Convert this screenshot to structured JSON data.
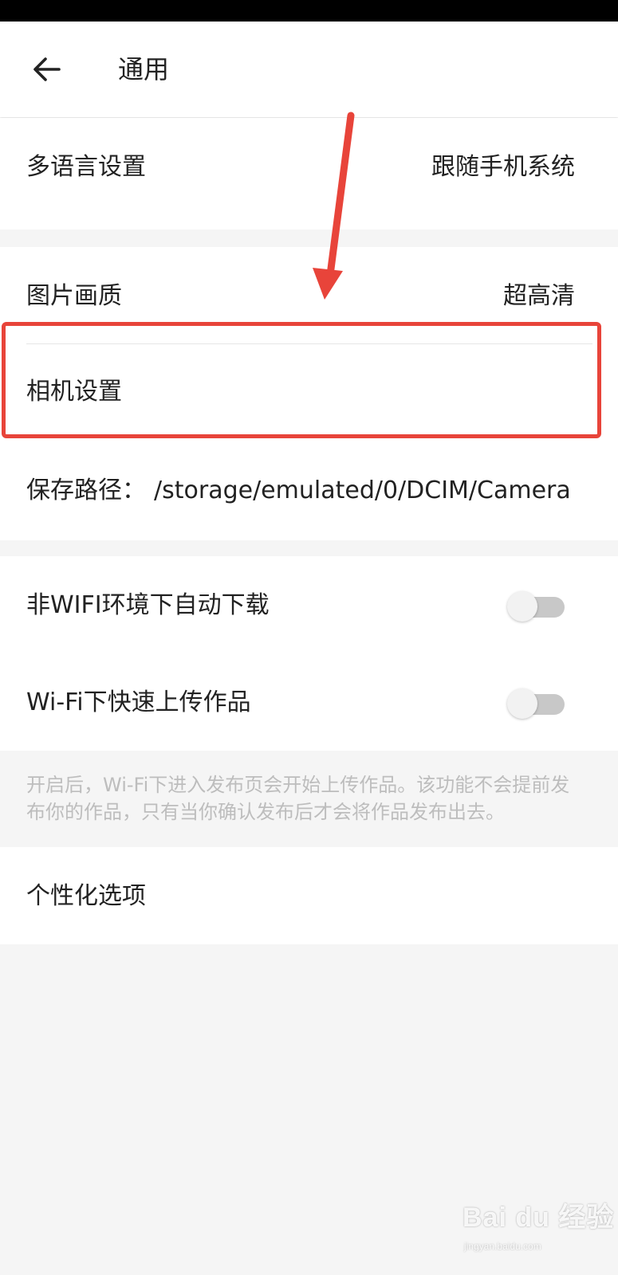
{
  "header": {
    "back_icon": "arrow-left-icon",
    "title": "通用"
  },
  "settings": {
    "language": {
      "label": "多语言设置",
      "value": "跟随手机系统"
    },
    "image_quality": {
      "label": "图片画质",
      "value": "超高清"
    },
    "camera": {
      "label": "相机设置"
    },
    "save_path": {
      "label": "保存路径：",
      "value": "/storage/emulated/0/DCIM/Camera"
    },
    "auto_download": {
      "label": "非WIFI环境下自动下载",
      "enabled": false
    },
    "wifi_upload": {
      "label": "Wi-Fi下快速上传作品",
      "enabled": false
    },
    "wifi_upload_description": "开启后，Wi-Fi下进入发布页会开始上传作品。该功能不会提前发布你的作品，只有当你确认发布后才会将作品发布出去。",
    "personalization": {
      "label": "个性化选项"
    }
  },
  "annotation": {
    "color": "#e8443a"
  },
  "watermark": {
    "brand": "Bai du 经验",
    "url": "jingyan.baidu.com"
  }
}
